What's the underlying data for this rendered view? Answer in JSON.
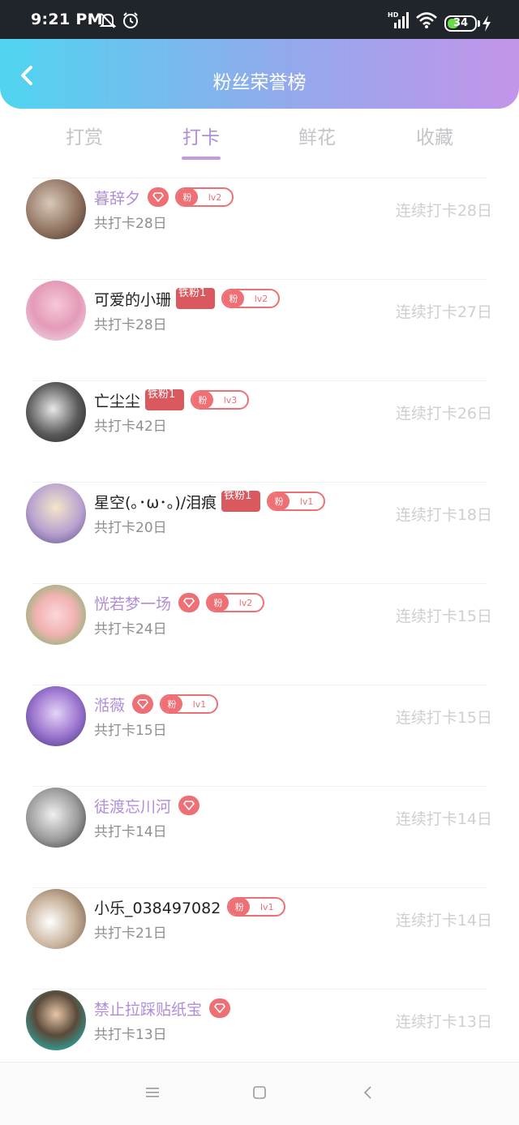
{
  "status_bar": {
    "time": "9:21 PM",
    "battery": "34"
  },
  "header": {
    "title": "粉丝荣誉榜"
  },
  "tabs": [
    {
      "label": "打赏"
    },
    {
      "label": "打卡"
    },
    {
      "label": "鲜花"
    },
    {
      "label": "收藏"
    }
  ],
  "active_tab": "打卡",
  "badge_text": {
    "fan_prefix": "粉",
    "tiefen": "铁粉1"
  },
  "rows": [
    {
      "name": "暮辞夕",
      "total": "共打卡28日",
      "streak": "连续打卡28日",
      "level": "lv2"
    },
    {
      "name": "可爱的小珊",
      "total": "共打卡28日",
      "streak": "连续打卡27日",
      "level": "lv2"
    },
    {
      "name": "亡尘尘",
      "total": "共打卡42日",
      "streak": "连续打卡26日",
      "level": "lv3"
    },
    {
      "name": "星空(｡･ω･｡)/泪痕",
      "total": "共打卡20日",
      "streak": "连续打卡18日",
      "level": "lv1"
    },
    {
      "name": "恍若梦一场",
      "total": "共打卡24日",
      "streak": "连续打卡15日",
      "level": "lv2"
    },
    {
      "name": "湉薇",
      "total": "共打卡15日",
      "streak": "连续打卡15日",
      "level": "lv1"
    },
    {
      "name": "徒渡忘川河",
      "total": "共打卡14日",
      "streak": "连续打卡14日",
      "level": ""
    },
    {
      "name": "小乐_038497082",
      "total": "共打卡21日",
      "streak": "连续打卡14日",
      "level": "lv1"
    },
    {
      "name": "禁止拉踩贴纸宝",
      "total": "共打卡13日",
      "streak": "连续打卡13日",
      "level": ""
    }
  ],
  "colors": {
    "accent": "#b08ed8",
    "badge_red": "#ee6f74",
    "header_start": "#4fd5f0",
    "header_end": "#c394ea"
  },
  "icons": [
    "back-arrow-icon",
    "bell-off-icon",
    "alarm-icon",
    "signal-icon",
    "wifi-icon",
    "charging-icon",
    "diamond-icon",
    "menu-icon",
    "home-icon",
    "back-nav-icon"
  ]
}
